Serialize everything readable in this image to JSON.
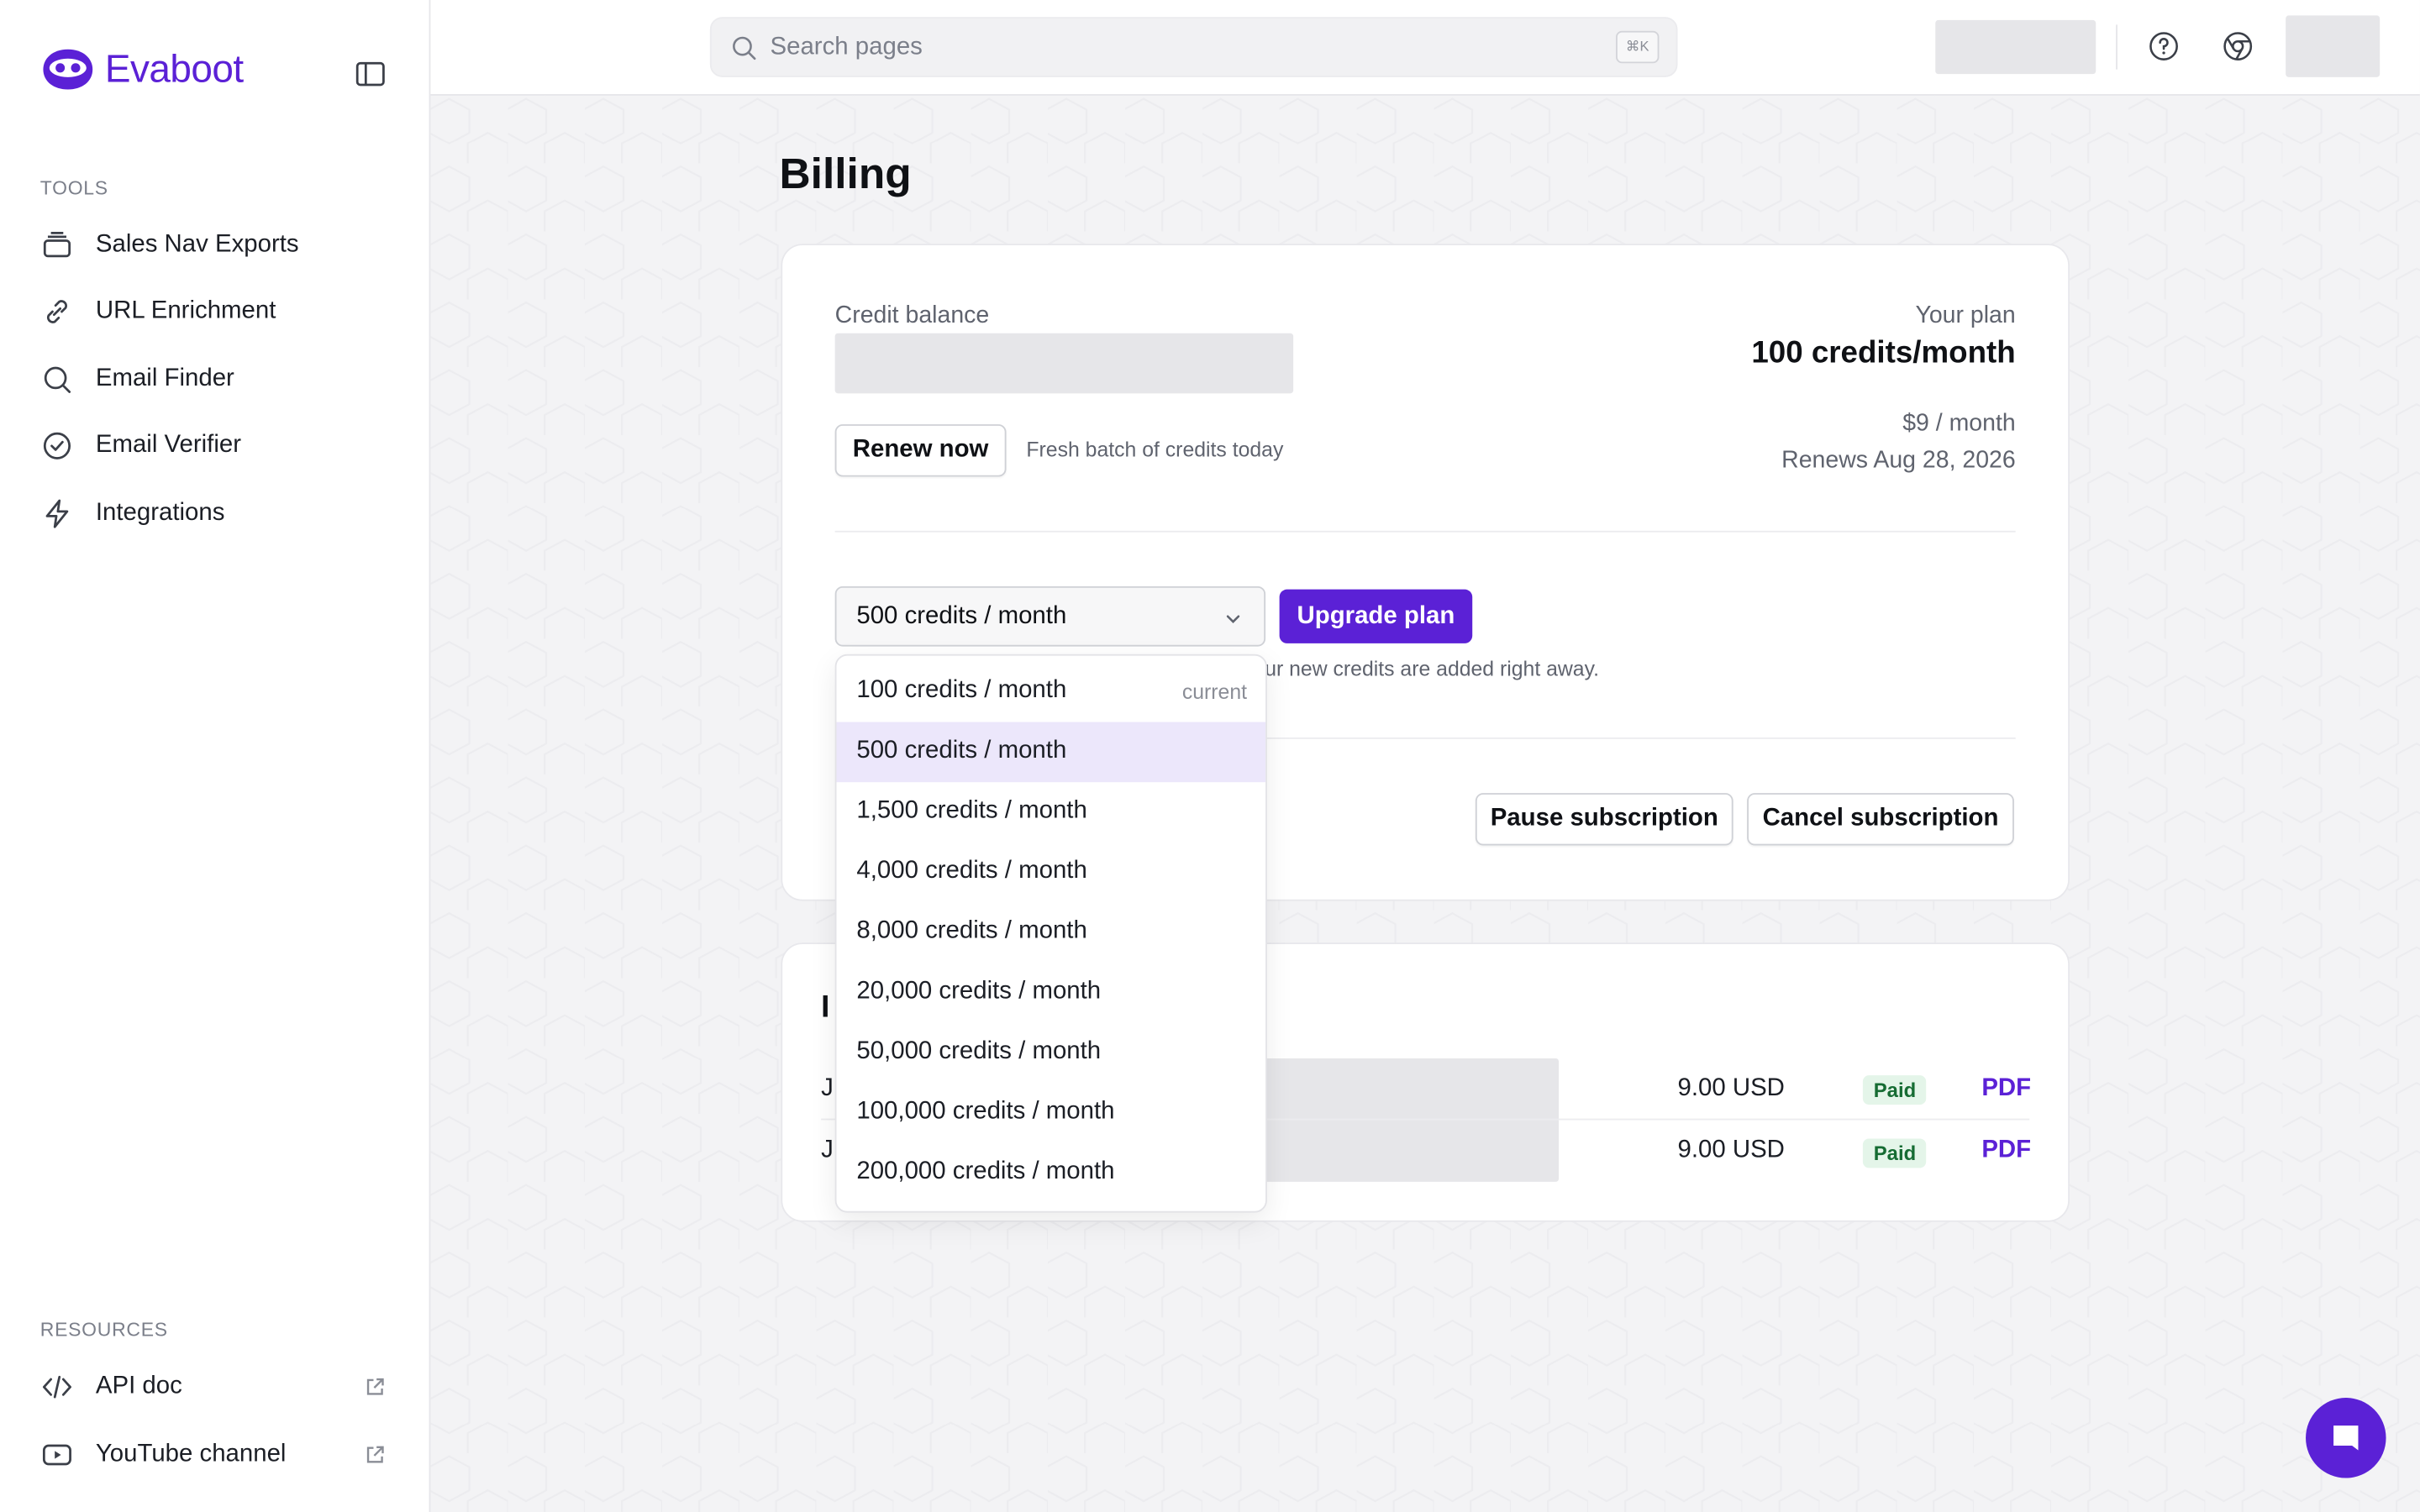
{
  "app": {
    "name": "Evaboot"
  },
  "sidebar": {
    "tools_label": "TOOLS",
    "tools": [
      {
        "label": "Sales Nav Exports",
        "icon": "stack-icon"
      },
      {
        "label": "URL Enrichment",
        "icon": "link-icon"
      },
      {
        "label": "Email Finder",
        "icon": "search-icon"
      },
      {
        "label": "Email Verifier",
        "icon": "check-circle-icon"
      },
      {
        "label": "Integrations",
        "icon": "lightning-icon"
      }
    ],
    "resources_label": "RESOURCES",
    "resources": [
      {
        "label": "API doc",
        "icon": "code-icon"
      },
      {
        "label": "YouTube channel",
        "icon": "youtube-icon"
      }
    ]
  },
  "topbar": {
    "search_placeholder": "Search pages",
    "shortcut": "⌘K"
  },
  "page": {
    "title": "Billing"
  },
  "plan_card": {
    "credit_balance_label": "Credit balance",
    "renew_button": "Renew now",
    "renew_note": "Fresh batch of credits today",
    "your_plan_label": "Your plan",
    "plan_name": "100 credits/month",
    "price": "$9 / month",
    "renews": "Renews Aug 28, 2026",
    "selected_plan": "500 credits / month",
    "upgrade_button": "Upgrade plan",
    "upgrade_note_visible": "our new credits are added right away.",
    "pause_button": "Pause subscription",
    "cancel_button": "Cancel subscription"
  },
  "dropdown": {
    "current_tag": "current",
    "options": [
      "100 credits / month",
      "500 credits / month",
      "1,500 credits / month",
      "4,000 credits / month",
      "8,000 credits / month",
      "20,000 credits / month",
      "50,000 credits / month",
      "100,000 credits / month",
      "200,000 credits / month"
    ]
  },
  "invoices": {
    "title_visible": "I",
    "rows": [
      {
        "date_visible": "J",
        "amount": "9.00 USD",
        "status": "Paid",
        "link": "PDF"
      },
      {
        "date_visible": "J",
        "amount": "9.00 USD",
        "status": "Paid",
        "link": "PDF"
      }
    ]
  },
  "colors": {
    "accent": "#5b21d6",
    "selected_option_bg": "#ece7fb",
    "paid_bg": "#e4f5e9",
    "paid_text": "#166c33"
  }
}
